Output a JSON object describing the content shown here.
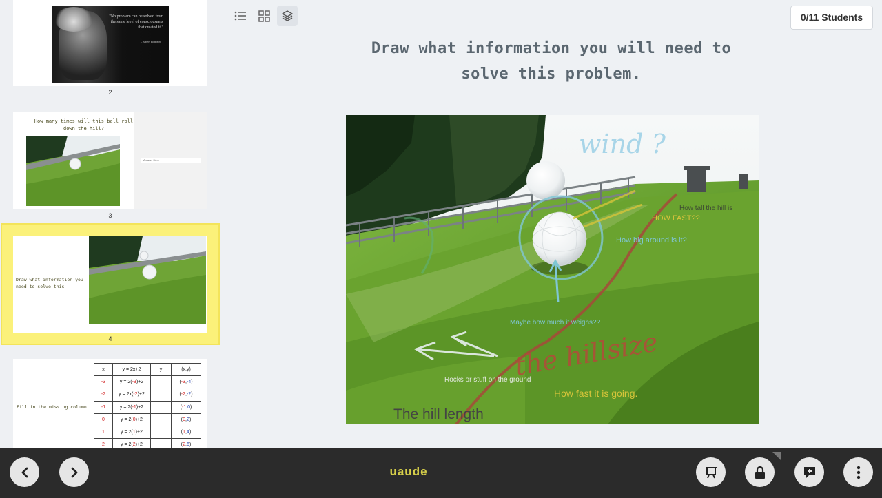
{
  "rail": {
    "slides": [
      {
        "number": "2",
        "quote": "\"No problem can be solved from the same level of consciousness that created it.\"",
        "author": "- Albert Einstein"
      },
      {
        "number": "3",
        "title": "How many times will this ball roll down the hill?",
        "answer_placeholder": "Answer Here"
      },
      {
        "number": "4",
        "text": "Draw what information you need to solve this problem."
      },
      {
        "number": "",
        "text": "Fill in the missing column",
        "table": {
          "headers": [
            "x",
            "y = 2x+2",
            "y",
            "(x,y)"
          ],
          "rows": [
            {
              "x": "-3",
              "expr_pre": "y = 2(",
              "expr_val": "-3",
              "expr_post": ")+2",
              "pt_open": "(",
              "pt_x": "-3",
              "pt_sep": ",",
              "pt_y": "-4",
              "pt_close": ")"
            },
            {
              "x": "-2",
              "expr_pre": "y = 2x(",
              "expr_val": "-2",
              "expr_post": ")+2",
              "pt_open": "(",
              "pt_x": "-2",
              "pt_sep": ",",
              "pt_y": "-2",
              "pt_close": ")"
            },
            {
              "x": "-1",
              "expr_pre": "y = 2(",
              "expr_val": "-1",
              "expr_post": ")+2",
              "pt_open": "(",
              "pt_x": "-1",
              "pt_sep": ",",
              "pt_y": "0",
              "pt_close": ")"
            },
            {
              "x": "0",
              "expr_pre": "y = 2(",
              "expr_val": "0",
              "expr_post": ")+2",
              "pt_open": "(",
              "pt_x": "0",
              "pt_sep": ",",
              "pt_y": "2",
              "pt_close": ")"
            },
            {
              "x": "1",
              "expr_pre": "y = 2(",
              "expr_val": "1",
              "expr_post": ")+2",
              "pt_open": "(",
              "pt_x": "1",
              "pt_sep": ",",
              "pt_y": "4",
              "pt_close": ")"
            },
            {
              "x": "2",
              "expr_pre": "y = 2(",
              "expr_val": "2",
              "expr_post": ")+2",
              "pt_open": "(",
              "pt_x": "2",
              "pt_sep": ",",
              "pt_y": "6",
              "pt_close": ")"
            }
          ]
        }
      }
    ]
  },
  "toolbar": {
    "icons": [
      "list-view-icon",
      "grid-view-icon",
      "layers-icon"
    ],
    "students_label": "0/11 Students"
  },
  "main": {
    "prompt": "Draw what information you will need to solve this problem.",
    "annotations": {
      "wind": "wind ?",
      "tall": "How tall the hill is",
      "fast_caps": "HOW FAST??",
      "around": "How big around is it?",
      "weighs": "Maybe how much it weighs??",
      "hillsize": "the hillsize",
      "rocks": "Rocks or stuff on the ground",
      "fast": "How fast it is going.",
      "length": "The hill length"
    }
  },
  "bottom": {
    "session_code": "uaude",
    "buttons": [
      "prev-slide",
      "next-slide",
      "present",
      "lock",
      "add-slide",
      "more"
    ]
  },
  "colors": {
    "highlight": "#fbf17a",
    "code": "#d6cf4a",
    "bar": "#2b2b2b",
    "prompt": "#5b6770"
  }
}
